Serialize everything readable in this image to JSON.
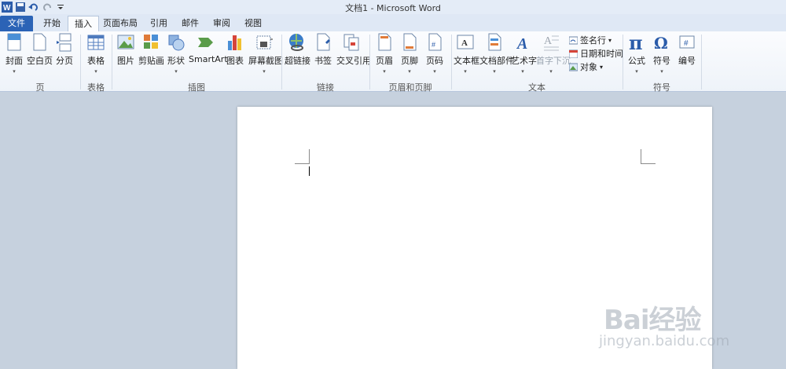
{
  "window": {
    "title": "文档1 - Microsoft Word"
  },
  "quick_access": {
    "icons": [
      "word-app-icon",
      "save-icon",
      "undo-icon",
      "redo-icon",
      "customize-icon"
    ]
  },
  "tabs": [
    "文件",
    "开始",
    "插入",
    "页面布局",
    "引用",
    "邮件",
    "审阅",
    "视图"
  ],
  "active_tab": "插入",
  "ribbon": {
    "pages": {
      "label": "页",
      "cover": "封面",
      "blank": "空白页",
      "break": "分页"
    },
    "tables": {
      "label": "表格",
      "table": "表格"
    },
    "illustrations": {
      "label": "插图",
      "picture": "图片",
      "clipart": "剪贴画",
      "shapes": "形状",
      "smartart": "SmartArt",
      "chart": "图表",
      "screenshot": "屏幕截图"
    },
    "links": {
      "label": "链接",
      "hyperlink": "超链接",
      "bookmark": "书签",
      "crossref": "交叉引用"
    },
    "header_footer": {
      "label": "页眉和页脚",
      "header": "页眉",
      "footer": "页脚",
      "page_number": "页码"
    },
    "text": {
      "label": "文本",
      "textbox": "文本框",
      "quickparts": "文档部件",
      "wordart": "艺术字",
      "dropcap": "首字下沉",
      "signature": "签名行",
      "datetime": "日期和时间",
      "object": "对象"
    },
    "symbols": {
      "label": "符号",
      "equation": "公式",
      "symbol": "符号",
      "numbering": "编号"
    }
  },
  "watermark": {
    "main": "Bai经验",
    "sub": "jingyan.baidu.com"
  }
}
